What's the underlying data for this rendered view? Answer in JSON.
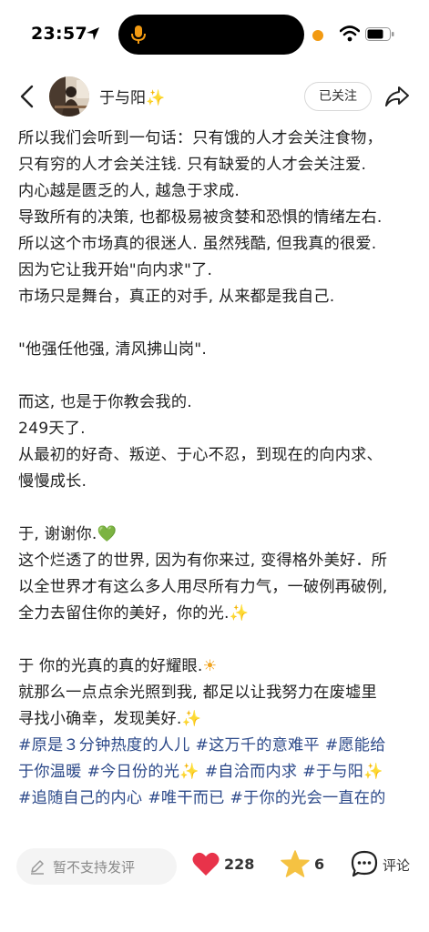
{
  "status_bar": {
    "time": "23:57",
    "icons": [
      "location-arrow-icon",
      "microphone-icon",
      "camera-indicator-icon",
      "wifi-icon",
      "battery-icon"
    ]
  },
  "header": {
    "author_name": "于与阳",
    "name_emoji": "✨",
    "follow_label": "已关注",
    "icons": [
      "back-icon",
      "avatar",
      "share-icon"
    ]
  },
  "post": {
    "lines": [
      "所以我们会听到一句话：只有饿的人才会关注食物，",
      "只有穷的人才会关注钱. 只有缺爱的人才会关注爱.",
      "内心越是匮乏的人, 越急于求成.",
      "导致所有的决策, 也都极易被贪婪和恐惧的情绪左右.",
      "所以这个市场真的很迷人. 虽然残酷, 但我真的很爱.",
      "因为它让我开始\"向内求\"了.",
      "市场只是舞台，真正的对手, 从来都是我自己."
    ],
    "quote": "\"他强任他强, 清风拂山岗\".",
    "lines2": [
      "而这, 也是于你教会我的.",
      "249天了.",
      "从最初的好奇、叛逆、于心不忍，到现在的向内求、",
      "慢慢成长."
    ],
    "thanks": "于, 谢谢你.",
    "thanks_emoji": "💚",
    "lines3": [
      "这个烂透了的世界, 因为有你来过, 变得格外美好．所",
      "以全世界才有这么多人用尽所有力气，一破例再破例,"
    ],
    "line3_last": "全力去留住你的美好，你的光.",
    "line3_emoji": "✨",
    "light_line": "于 你的光真的真的好耀眼.",
    "light_emoji": "☀",
    "line4": "就那么一点点余光照到我, 都足以让我努力在废墟里",
    "line5": "寻找小确幸，发现美好.",
    "line5_emoji": "✨",
    "hashtags": {
      "t1": "#原是３分钟热度的人儿",
      "t2": "#这万千的意难平",
      "t3a": "#愿能给",
      "t3b": "于你温暖",
      "t4": "#今日份的光✨",
      "t5": "#自洽而内求",
      "t6": "#于与阳✨",
      "t7": "#追随自己的内心",
      "t8": "#唯干而已",
      "t9": "#于你的光会一直在的"
    }
  },
  "bottom_bar": {
    "comment_placeholder": "暂不支持发评",
    "likes": "228",
    "favorites": "6",
    "comment_label": "评论",
    "colors": {
      "like": "#e8334a",
      "favorite": "#f5c242"
    }
  }
}
